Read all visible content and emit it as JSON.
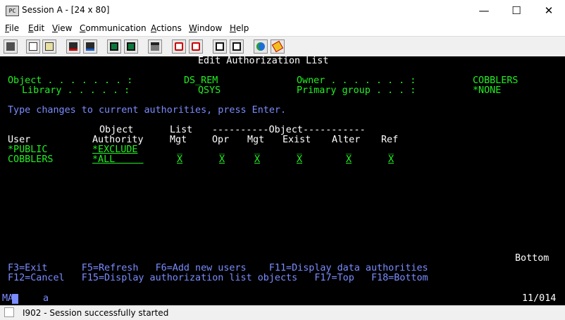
{
  "window": {
    "title": "Session A - [24 x 80]",
    "minimize": "—",
    "maximize": "☐",
    "close": "✕"
  },
  "menu": {
    "items": [
      {
        "key": "F",
        "rest": "ile"
      },
      {
        "key": "E",
        "rest": "dit"
      },
      {
        "key": "V",
        "rest": "iew"
      },
      {
        "key": "C",
        "rest": "ommunication"
      },
      {
        "key": "A",
        "rest": "ctions"
      },
      {
        "key": "W",
        "rest": "indow"
      },
      {
        "key": "H",
        "rest": "elp"
      }
    ]
  },
  "toolbar": {
    "icons": [
      "print-screen-icon",
      "copy-icon",
      "paste-icon",
      "send-icon",
      "receive-icon",
      "display-keypad-icon",
      "quick-keys-icon",
      "record-macro-icon",
      "stop-macro-icon",
      "play-macro-icon",
      "customize-icon",
      "cut-icon",
      "support-icon",
      "edit-icon"
    ]
  },
  "screen": {
    "title": "Edit Authorization List",
    "object_label": "Object . . . . . . . :",
    "object_value": "DS_REM",
    "library_label": "Library . . . . . :",
    "library_value": "QSYS",
    "owner_label": "Owner . . . . . . . :",
    "owner_value": "COBBLERS",
    "group_label": "Primary group . . . :",
    "group_value": "*NONE",
    "instruction": "Type changes to current authorities, press Enter.",
    "head1_object": "Object",
    "head1_list": "List",
    "head1_group": "----------Object-----------",
    "head2_user": "User",
    "head2_authority": "Authority",
    "head2_listmgt": "Mgt",
    "head2_opr": "Opr",
    "head2_mgt": "Mgt",
    "head2_exist": "Exist",
    "head2_alter": "Alter",
    "head2_ref": "Ref",
    "rows": [
      {
        "user": "*PUBLIC",
        "authority": "*EXCLUDE",
        "listmgt": "_",
        "opr": "_",
        "mgt": "_",
        "exist": "_",
        "alter": "_",
        "ref": "_"
      },
      {
        "user": "COBBLERS",
        "authority": "*ALL     ",
        "listmgt": "X",
        "opr": "X",
        "mgt": "X",
        "exist": "X",
        "alter": "X",
        "ref": "X"
      }
    ],
    "more": "Bottom",
    "fkeys_line1": "F3=Exit      F5=Refresh   F6=Add new users    F11=Display data authorities",
    "fkeys_line2": "F12=Cancel   F15=Display authorization list objects   F17=Top   F18=Bottom"
  },
  "oia": {
    "indicator": "MA",
    "input_char": "a",
    "cursor_position": "11/014"
  },
  "status": {
    "message": "I902 - Session successfully started"
  }
}
